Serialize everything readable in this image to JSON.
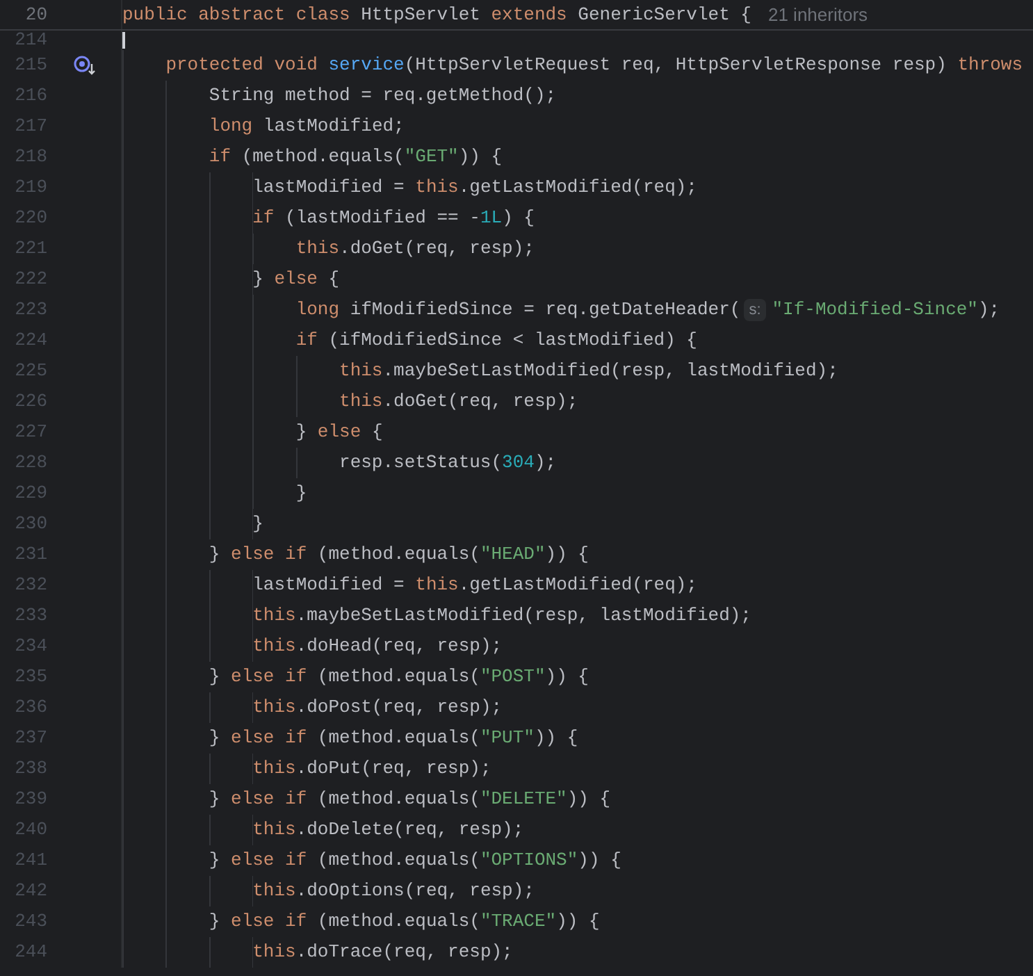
{
  "sticky_header": {
    "number": "20",
    "tokens": [
      {
        "kind": "keyword",
        "text": "public abstract class"
      },
      {
        "kind": "plain",
        "text": " HttpServlet "
      },
      {
        "kind": "keyword",
        "text": "extends"
      },
      {
        "kind": "plain",
        "text": " GenericServlet {"
      }
    ],
    "hint": "21 inheritors"
  },
  "lines": [
    {
      "number": "214",
      "cursor": true
    },
    {
      "number": "215",
      "gutter_icon": true,
      "tokens": [
        {
          "kind": "keyword",
          "text": "    protected void "
        },
        {
          "kind": "declaration",
          "text": "service"
        },
        {
          "kind": "plain",
          "text": "(HttpServletRequest req, HttpServletResponse resp) "
        },
        {
          "kind": "keyword",
          "text": "throws"
        }
      ]
    },
    {
      "number": "216",
      "tokens": [
        {
          "kind": "plain",
          "text": "        String method = req.getMethod();"
        }
      ]
    },
    {
      "number": "217",
      "tokens": [
        {
          "kind": "keyword",
          "text": "        long"
        },
        {
          "kind": "plain",
          "text": " lastModified;"
        }
      ]
    },
    {
      "number": "218",
      "tokens": [
        {
          "kind": "keyword",
          "text": "        if"
        },
        {
          "kind": "plain",
          "text": " (method.equals("
        },
        {
          "kind": "string",
          "text": "\"GET\""
        },
        {
          "kind": "plain",
          "text": ")) {"
        }
      ]
    },
    {
      "number": "219",
      "tokens": [
        {
          "kind": "plain",
          "text": "            lastModified = "
        },
        {
          "kind": "keyword",
          "text": "this"
        },
        {
          "kind": "plain",
          "text": ".getLastModified(req);"
        }
      ]
    },
    {
      "number": "220",
      "tokens": [
        {
          "kind": "keyword",
          "text": "            if"
        },
        {
          "kind": "plain",
          "text": " (lastModified == -"
        },
        {
          "kind": "number",
          "text": "1L"
        },
        {
          "kind": "plain",
          "text": ") {"
        }
      ]
    },
    {
      "number": "221",
      "tokens": [
        {
          "kind": "keyword",
          "text": "                this"
        },
        {
          "kind": "plain",
          "text": ".doGet(req, resp);"
        }
      ]
    },
    {
      "number": "222",
      "tokens": [
        {
          "kind": "plain",
          "text": "            } "
        },
        {
          "kind": "keyword",
          "text": "else"
        },
        {
          "kind": "plain",
          "text": " {"
        }
      ]
    },
    {
      "number": "223",
      "tokens": [
        {
          "kind": "keyword",
          "text": "                long"
        },
        {
          "kind": "plain",
          "text": " ifModifiedSince = req.getDateHeader("
        },
        {
          "kind": "hint",
          "text": "s:"
        },
        {
          "kind": "string",
          "text": "\"If-Modified-Since\""
        },
        {
          "kind": "plain",
          "text": ");"
        }
      ]
    },
    {
      "number": "224",
      "tokens": [
        {
          "kind": "keyword",
          "text": "                if"
        },
        {
          "kind": "plain",
          "text": " (ifModifiedSince < lastModified) {"
        }
      ]
    },
    {
      "number": "225",
      "tokens": [
        {
          "kind": "keyword",
          "text": "                    this"
        },
        {
          "kind": "plain",
          "text": ".maybeSetLastModified(resp, lastModified);"
        }
      ]
    },
    {
      "number": "226",
      "tokens": [
        {
          "kind": "keyword",
          "text": "                    this"
        },
        {
          "kind": "plain",
          "text": ".doGet(req, resp);"
        }
      ]
    },
    {
      "number": "227",
      "tokens": [
        {
          "kind": "plain",
          "text": "                } "
        },
        {
          "kind": "keyword",
          "text": "else"
        },
        {
          "kind": "plain",
          "text": " {"
        }
      ]
    },
    {
      "number": "228",
      "tokens": [
        {
          "kind": "plain",
          "text": "                    resp.setStatus("
        },
        {
          "kind": "number",
          "text": "304"
        },
        {
          "kind": "plain",
          "text": ");"
        }
      ]
    },
    {
      "number": "229",
      "tokens": [
        {
          "kind": "plain",
          "text": "                }"
        }
      ]
    },
    {
      "number": "230",
      "tokens": [
        {
          "kind": "plain",
          "text": "            }"
        }
      ]
    },
    {
      "number": "231",
      "tokens": [
        {
          "kind": "plain",
          "text": "        } "
        },
        {
          "kind": "keyword",
          "text": "else if"
        },
        {
          "kind": "plain",
          "text": " (method.equals("
        },
        {
          "kind": "string",
          "text": "\"HEAD\""
        },
        {
          "kind": "plain",
          "text": ")) {"
        }
      ]
    },
    {
      "number": "232",
      "tokens": [
        {
          "kind": "plain",
          "text": "            lastModified = "
        },
        {
          "kind": "keyword",
          "text": "this"
        },
        {
          "kind": "plain",
          "text": ".getLastModified(req);"
        }
      ]
    },
    {
      "number": "233",
      "tokens": [
        {
          "kind": "keyword",
          "text": "            this"
        },
        {
          "kind": "plain",
          "text": ".maybeSetLastModified(resp, lastModified);"
        }
      ]
    },
    {
      "number": "234",
      "tokens": [
        {
          "kind": "keyword",
          "text": "            this"
        },
        {
          "kind": "plain",
          "text": ".doHead(req, resp);"
        }
      ]
    },
    {
      "number": "235",
      "tokens": [
        {
          "kind": "plain",
          "text": "        } "
        },
        {
          "kind": "keyword",
          "text": "else if"
        },
        {
          "kind": "plain",
          "text": " (method.equals("
        },
        {
          "kind": "string",
          "text": "\"POST\""
        },
        {
          "kind": "plain",
          "text": ")) {"
        }
      ]
    },
    {
      "number": "236",
      "tokens": [
        {
          "kind": "keyword",
          "text": "            this"
        },
        {
          "kind": "plain",
          "text": ".doPost(req, resp);"
        }
      ]
    },
    {
      "number": "237",
      "tokens": [
        {
          "kind": "plain",
          "text": "        } "
        },
        {
          "kind": "keyword",
          "text": "else if"
        },
        {
          "kind": "plain",
          "text": " (method.equals("
        },
        {
          "kind": "string",
          "text": "\"PUT\""
        },
        {
          "kind": "plain",
          "text": ")) {"
        }
      ]
    },
    {
      "number": "238",
      "tokens": [
        {
          "kind": "keyword",
          "text": "            this"
        },
        {
          "kind": "plain",
          "text": ".doPut(req, resp);"
        }
      ]
    },
    {
      "number": "239",
      "tokens": [
        {
          "kind": "plain",
          "text": "        } "
        },
        {
          "kind": "keyword",
          "text": "else if"
        },
        {
          "kind": "plain",
          "text": " (method.equals("
        },
        {
          "kind": "string",
          "text": "\"DELETE\""
        },
        {
          "kind": "plain",
          "text": ")) {"
        }
      ]
    },
    {
      "number": "240",
      "tokens": [
        {
          "kind": "keyword",
          "text": "            this"
        },
        {
          "kind": "plain",
          "text": ".doDelete(req, resp);"
        }
      ]
    },
    {
      "number": "241",
      "tokens": [
        {
          "kind": "plain",
          "text": "        } "
        },
        {
          "kind": "keyword",
          "text": "else if"
        },
        {
          "kind": "plain",
          "text": " (method.equals("
        },
        {
          "kind": "string",
          "text": "\"OPTIONS\""
        },
        {
          "kind": "plain",
          "text": ")) {"
        }
      ]
    },
    {
      "number": "242",
      "tokens": [
        {
          "kind": "keyword",
          "text": "            this"
        },
        {
          "kind": "plain",
          "text": ".doOptions(req, resp);"
        }
      ]
    },
    {
      "number": "243",
      "tokens": [
        {
          "kind": "plain",
          "text": "        } "
        },
        {
          "kind": "keyword",
          "text": "else if"
        },
        {
          "kind": "plain",
          "text": " (method.equals("
        },
        {
          "kind": "string",
          "text": "\"TRACE\""
        },
        {
          "kind": "plain",
          "text": ")) {"
        }
      ]
    },
    {
      "number": "244",
      "tokens": [
        {
          "kind": "keyword",
          "text": "            this"
        },
        {
          "kind": "plain",
          "text": ".doTrace(req, resp);"
        }
      ]
    }
  ]
}
